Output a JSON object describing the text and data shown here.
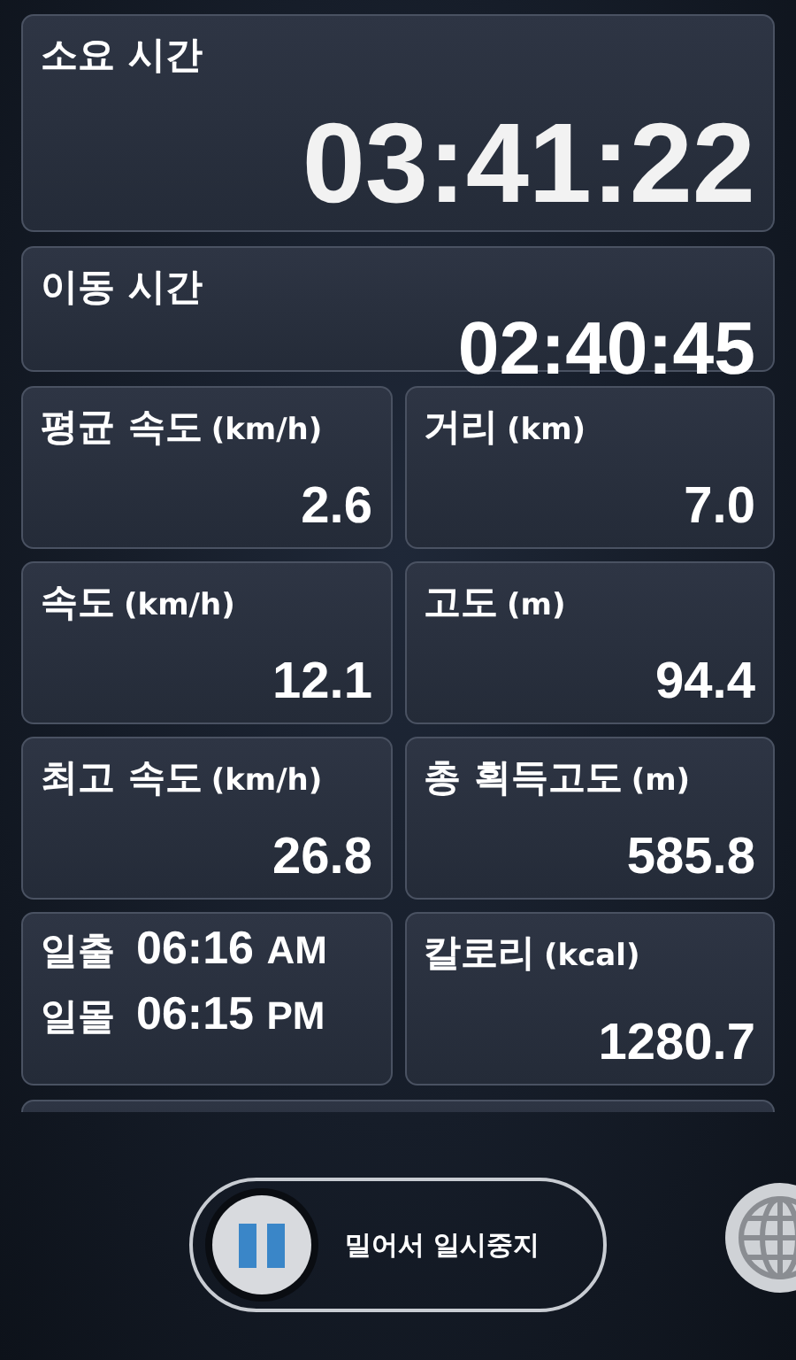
{
  "total_time": {
    "label": "소요 시간",
    "value": "03:41:22"
  },
  "moving_time": {
    "label": "이동 시간",
    "value": "02:40:45"
  },
  "stats": [
    {
      "kind": "stat",
      "label": "평균 속도",
      "unit": "(km/h)",
      "value": "2.6"
    },
    {
      "kind": "stat",
      "label": "거리",
      "unit": "(km)",
      "value": "7.0"
    },
    {
      "kind": "stat",
      "label": "속도",
      "unit": "(km/h)",
      "value": "12.1"
    },
    {
      "kind": "stat",
      "label": "고도",
      "unit": "(m)",
      "value": "94.4"
    },
    {
      "kind": "stat",
      "label": "최고 속도",
      "unit": "(km/h)",
      "value": "26.8"
    },
    {
      "kind": "stat",
      "label": "총 획득고도",
      "unit": "(m)",
      "value": "585.8"
    },
    {
      "kind": "sun",
      "rows": [
        {
          "label": "일출",
          "time": "06:16",
          "ampm": "AM"
        },
        {
          "label": "일몰",
          "time": "06:15",
          "ampm": "PM"
        }
      ]
    },
    {
      "kind": "stat",
      "label": "칼로리",
      "unit": "(kcal)",
      "value": "1280.7"
    }
  ],
  "pause_slider": {
    "label": "밀어서 일시중지",
    "level": 0
  }
}
